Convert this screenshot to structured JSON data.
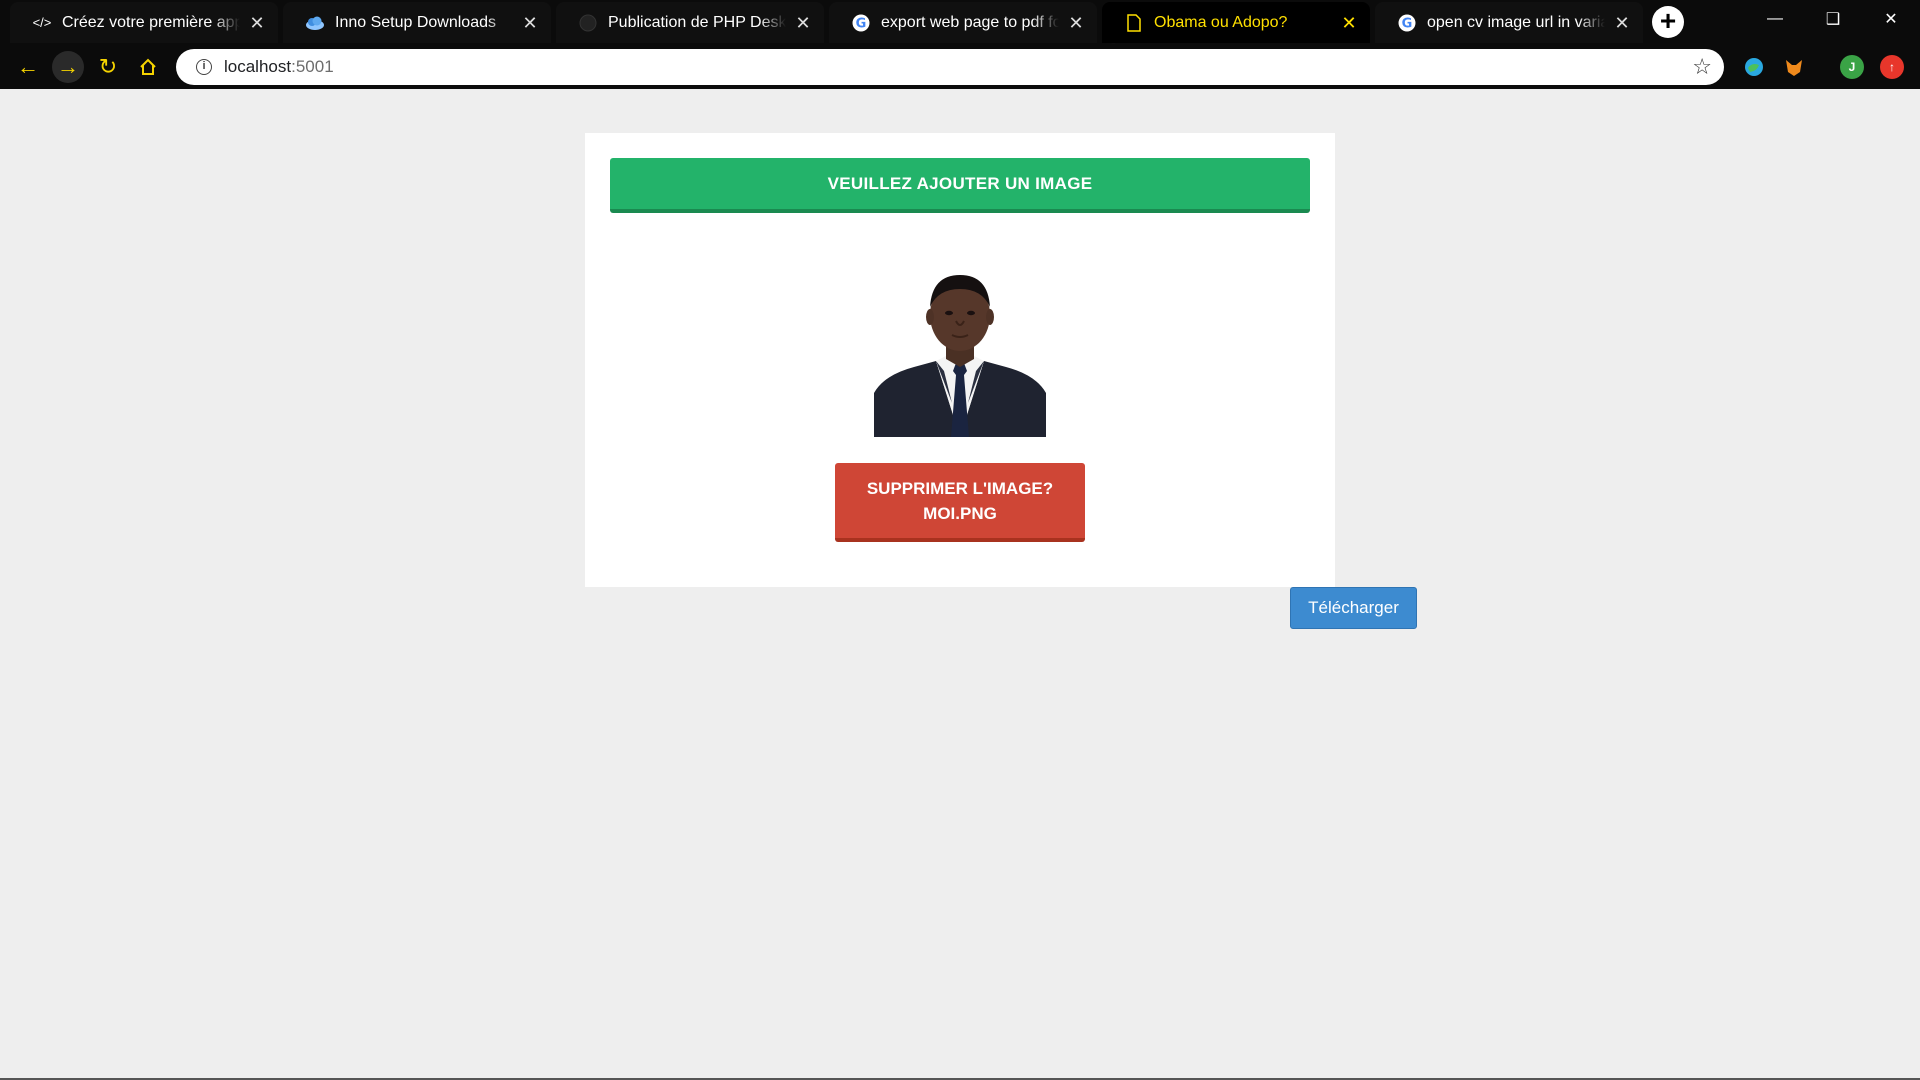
{
  "browser": {
    "tabs": [
      {
        "icon": "code-icon",
        "title": "Créez votre première applica",
        "active": false
      },
      {
        "icon": "cloud-icon",
        "title": "Inno Setup Downloads",
        "active": false
      },
      {
        "icon": "github-icon",
        "title": "Publication de PHP Desktop",
        "active": false
      },
      {
        "icon": "google-icon",
        "title": "export web page to pdf form",
        "active": false
      },
      {
        "icon": "page-icon",
        "title": "Obama ou Adopo?",
        "active": true
      },
      {
        "icon": "google-icon",
        "title": "open cv image url in variable",
        "active": false
      }
    ],
    "close_glyph": "✕",
    "new_tab_glyph": "+",
    "address": {
      "host": "localhost",
      "port": ":5001"
    },
    "profile_initial": "J"
  },
  "page": {
    "add_image_label": "VEUILLEZ AJOUTER UN IMAGE",
    "remove_image_line1": "SUPPRIMER L'IMAGE?",
    "remove_image_line2": "MOI.PNG",
    "download_label": "Télécharger"
  },
  "colors": {
    "add_button": "#23b36a",
    "remove_button": "#cf4636",
    "download_button": "#3d8bd0",
    "active_tab_text": "#ffe000"
  }
}
